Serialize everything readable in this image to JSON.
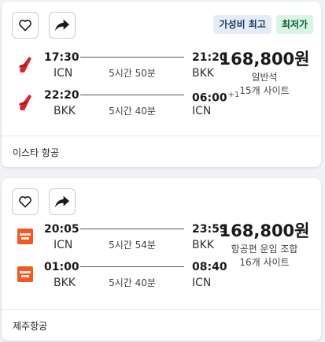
{
  "cards": [
    {
      "badges": {
        "value": "가성비 최고",
        "cheap": "최저가"
      },
      "airline_logo_color": "#d6252e",
      "legs": [
        {
          "dep_time": "17:30",
          "dep_code": "ICN",
          "duration": "5시간 50분",
          "arr_time": "21:20",
          "arr_day_offset": "",
          "arr_code": "BKK"
        },
        {
          "dep_time": "22:20",
          "dep_code": "BKK",
          "duration": "5시간 40분",
          "arr_time": "06:00",
          "arr_day_offset": "+1",
          "arr_code": "ICN"
        }
      ],
      "price": "168,800원",
      "fare_type": "일반석",
      "site_count": "15개 사이트",
      "airline": "이스타 항공"
    },
    {
      "airline_logo_color": "#f05a22",
      "legs": [
        {
          "dep_time": "20:05",
          "dep_code": "ICN",
          "duration": "5시간 54분",
          "arr_time": "23:59",
          "arr_day_offset": "",
          "arr_code": "BKK"
        },
        {
          "dep_time": "01:00",
          "dep_code": "BKK",
          "duration": "5시간 40분",
          "arr_time": "08:40",
          "arr_day_offset": "",
          "arr_code": "ICN"
        }
      ],
      "price": "168,800원",
      "fare_type": "항공편 운임 조합",
      "site_count": "16개 사이트",
      "airline": "제주항공"
    }
  ],
  "icons": {
    "favorite": "heart-outline-icon",
    "share": "share-arrow-icon"
  },
  "colors": {
    "badge_value_bg": "#e4ecf7",
    "badge_cheap_bg": "#d9f4e3"
  }
}
